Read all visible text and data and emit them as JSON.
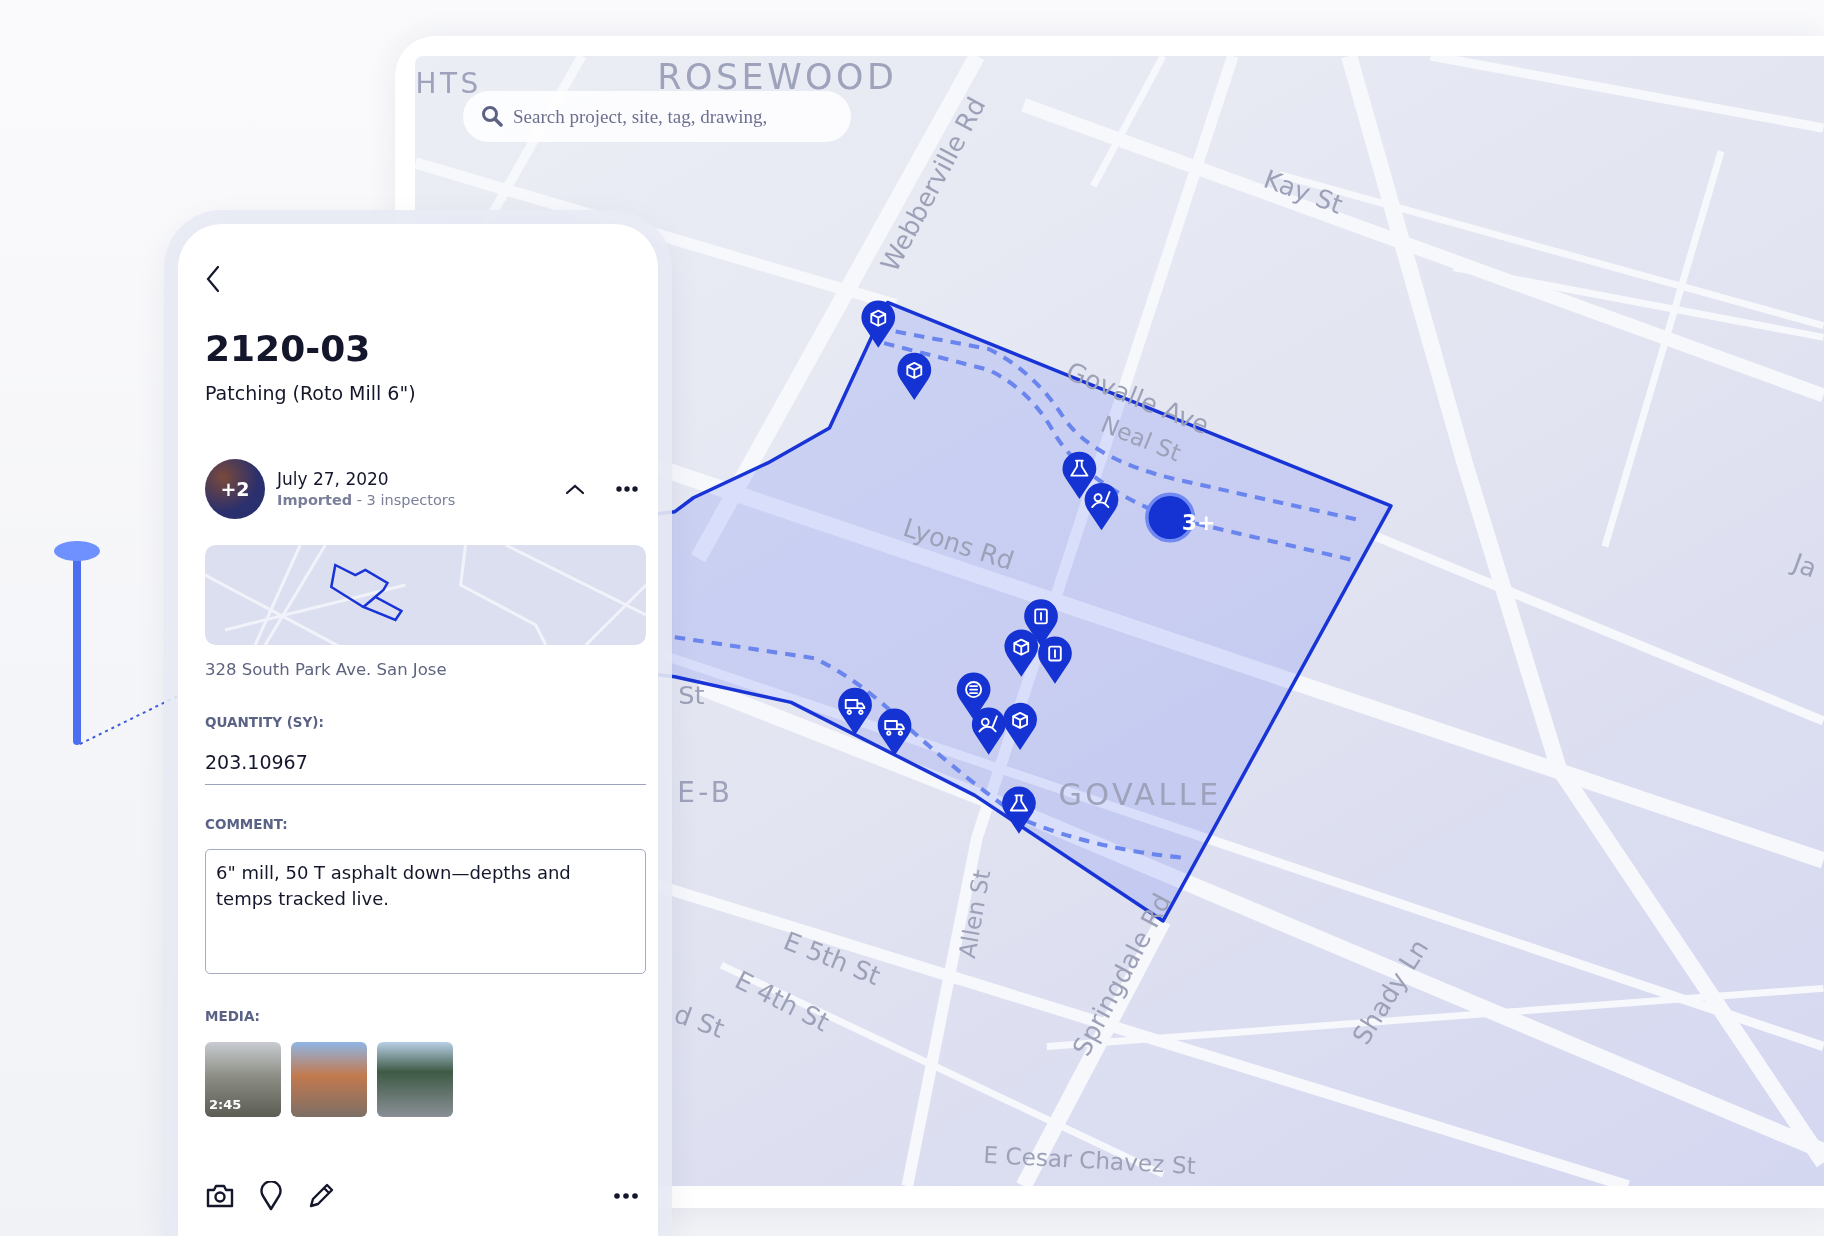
{
  "map": {
    "search": {
      "placeholder": "Search project, site, tag, drawing,"
    },
    "labels": [
      {
        "kind": "area",
        "text": "HTS"
      },
      {
        "kind": "area",
        "text": "ROSEWOOD"
      },
      {
        "kind": "street",
        "text": "Webberville Rd"
      },
      {
        "kind": "street",
        "text": "Kay St"
      },
      {
        "kind": "street",
        "text": "Govalle Ave"
      },
      {
        "kind": "street",
        "text": "Neal St"
      },
      {
        "kind": "street",
        "text": "Lyons Rd"
      },
      {
        "kind": "street",
        "text": "Ja"
      },
      {
        "kind": "street",
        "text": "St"
      },
      {
        "kind": "area",
        "text": "E-B"
      },
      {
        "kind": "area",
        "text": "GOVALLE"
      },
      {
        "kind": "street",
        "text": "Allen St"
      },
      {
        "kind": "street",
        "text": "E 5th St"
      },
      {
        "kind": "street",
        "text": "E 4th St"
      },
      {
        "kind": "street",
        "text": "d St"
      },
      {
        "kind": "street",
        "text": "Springdale Rd"
      },
      {
        "kind": "street",
        "text": "Shady Ln"
      },
      {
        "kind": "street",
        "text": "E Cesar Chavez St"
      }
    ],
    "markers": [
      {
        "kind": "cube"
      },
      {
        "kind": "cube"
      },
      {
        "kind": "flask"
      },
      {
        "kind": "roller"
      },
      {
        "kind": "info"
      },
      {
        "kind": "cube"
      },
      {
        "kind": "info"
      },
      {
        "kind": "list"
      },
      {
        "kind": "truck"
      },
      {
        "kind": "truck"
      },
      {
        "kind": "roller"
      },
      {
        "kind": "cube"
      },
      {
        "kind": "flask"
      }
    ],
    "cluster": {
      "count": "3+"
    }
  },
  "record": {
    "title": "2120-03",
    "subtitle": "Patching (Roto Mill 6\")",
    "avatar": {
      "count": "+2"
    },
    "date": "July 27, 2020",
    "status": "**Imported** - 3 inspectors",
    "expanded": true,
    "address": "328 South Park Ave. San Jose",
    "fields": [
      {
        "kind": "line",
        "label": "QUANTITY (SY):",
        "value": "203.10967"
      },
      {
        "kind": "area",
        "label": "COMMENT:",
        "value": "6\" mill, 50 T asphalt down—depths and temps tracked live."
      }
    ],
    "media": {
      "label": "MEDIA:",
      "items": [
        {
          "kind": "video",
          "duration": "2:45"
        },
        {
          "kind": "photo"
        },
        {
          "kind": "photo"
        }
      ]
    }
  }
}
